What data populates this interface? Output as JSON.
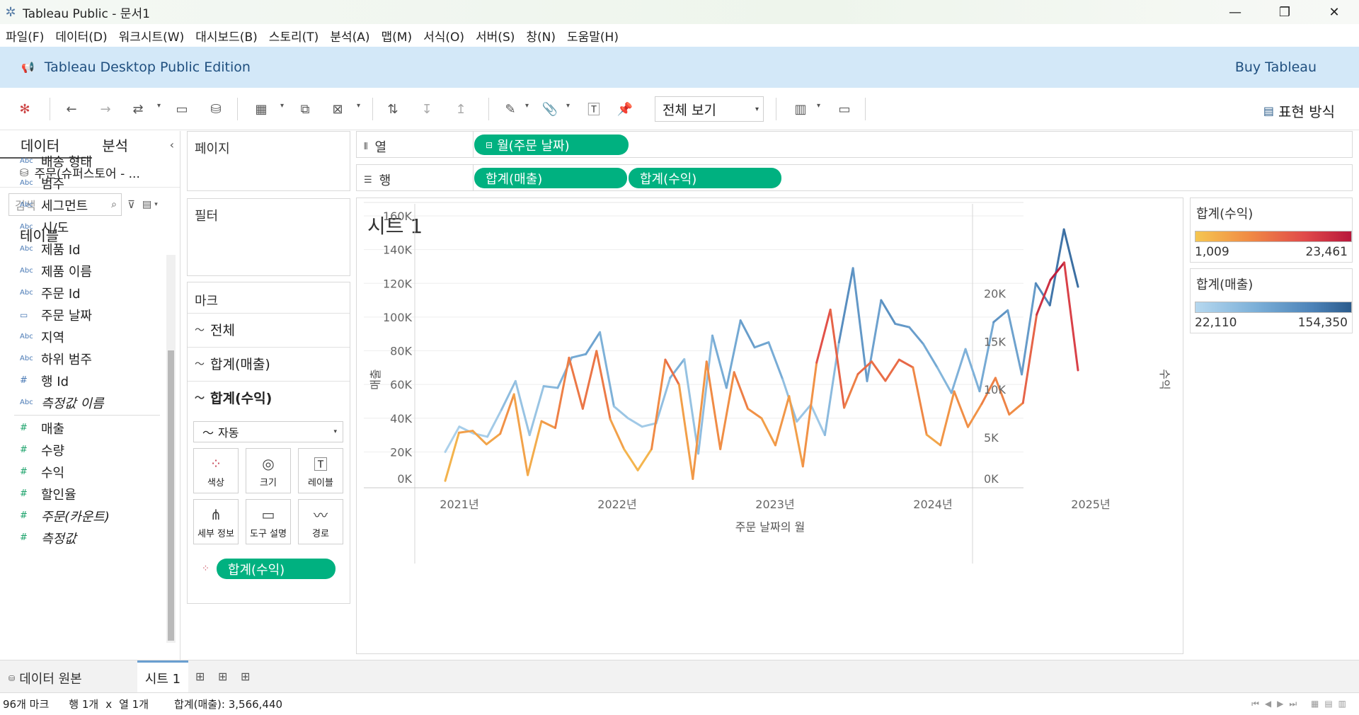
{
  "window": {
    "title": "Tableau Public - 문서1",
    "minimize_glyph": "—",
    "maximize_glyph": "❐",
    "close_glyph": "✕"
  },
  "menu": [
    "파일(F)",
    "데이터(D)",
    "워크시트(W)",
    "대시보드(B)",
    "스토리(T)",
    "분석(A)",
    "맵(M)",
    "서식(O)",
    "서버(S)",
    "창(N)",
    "도움말(H)"
  ],
  "banner": {
    "edition": "Tableau Desktop Public Edition",
    "buy": "Buy Tableau"
  },
  "toolbar": {
    "fit_value": "전체 보기",
    "show_me": "표현 방식",
    "icons": [
      "tableau-logo-icon",
      "undo-icon",
      "redo-icon",
      "replay-icon",
      "save-icon",
      "new-datasource-icon",
      "new-worksheet-icon",
      "duplicate-icon",
      "clear-icon",
      "swap-icon",
      "sort-asc-icon",
      "sort-desc-icon",
      "highlight-icon",
      "group-icon",
      "label-icon",
      "pin-icon",
      "chart-size-icon",
      "presentation-icon"
    ]
  },
  "data_pane": {
    "tab_data": "데이터",
    "tab_analysis": "분석",
    "datasource": "주문(슈퍼스토어 - ...",
    "search_placeholder": "검색",
    "tables_heading": "테이블",
    "dimensions": [
      {
        "type": "Abc",
        "name": "배송 형태"
      },
      {
        "type": "Abc",
        "name": "범주"
      },
      {
        "type": "Abc",
        "name": "세그먼트"
      },
      {
        "type": "Abc",
        "name": "시/도"
      },
      {
        "type": "Abc",
        "name": "제품 Id"
      },
      {
        "type": "Abc",
        "name": "제품 이름"
      },
      {
        "type": "Abc",
        "name": "주문 Id"
      },
      {
        "type": "date",
        "name": "주문 날짜"
      },
      {
        "type": "Abc",
        "name": "지역"
      },
      {
        "type": "Abc",
        "name": "하위 범주"
      },
      {
        "type": "#",
        "name": "행 Id"
      },
      {
        "type": "Abc",
        "name": "측정값 이름"
      }
    ],
    "measures": [
      {
        "type": "#",
        "name": "매출"
      },
      {
        "type": "#",
        "name": "수량"
      },
      {
        "type": "#",
        "name": "수익"
      },
      {
        "type": "#",
        "name": "할인율"
      },
      {
        "type": "#",
        "name": "주문(카운트)"
      },
      {
        "type": "#",
        "name": "측정값"
      }
    ]
  },
  "shelves": {
    "pages": "페이지",
    "filters": "필터",
    "marks": "마크",
    "columns_label": "열",
    "rows_label": "행",
    "column_pill": "월(주문 날짜)",
    "row_pills": [
      "합계(매출)",
      "합계(수익)"
    ]
  },
  "marks": {
    "all": "전체",
    "sales": "합계(매출)",
    "profit": "합계(수익)",
    "mark_type": "자동",
    "buttons": [
      {
        "label": "색상",
        "icon": "color-icon"
      },
      {
        "label": "크기",
        "icon": "size-icon"
      },
      {
        "label": "레이블",
        "icon": "label-icon"
      },
      {
        "label": "세부 정보",
        "icon": "detail-icon"
      },
      {
        "label": "도구 설명",
        "icon": "tooltip-icon"
      },
      {
        "label": "경로",
        "icon": "path-icon"
      }
    ],
    "color_pill": "합계(수익)"
  },
  "legends": {
    "profit": {
      "title": "합계(수익)",
      "min": "1,009",
      "max": "23,461"
    },
    "sales": {
      "title": "합계(매출)",
      "min": "22,110",
      "max": "154,350"
    }
  },
  "sheet": {
    "title": "시트 1"
  },
  "chart_data": {
    "type": "line",
    "xlabel": "주문 날짜의 월",
    "ylabel_left": "매출",
    "ylabel_right": "수익",
    "x_ticks": [
      "2021년",
      "2022년",
      "2023년",
      "2024년",
      "2025년"
    ],
    "x_start": "2021-01",
    "x_end": "2024-12",
    "y_left_ticks": [
      "0K",
      "20K",
      "40K",
      "60K",
      "80K",
      "100K",
      "120K",
      "140K",
      "160K"
    ],
    "y_left_range": [
      0,
      160000
    ],
    "y_right_ticks": [
      "0K",
      "5K",
      "10K",
      "15K",
      "20K"
    ],
    "y_right_range": [
      0,
      24000
    ],
    "grid": true,
    "series": [
      {
        "name": "합계(매출)",
        "axis": "left",
        "color_measure": "sales",
        "values": [
          20000,
          35000,
          31000,
          29000,
          45000,
          62000,
          30000,
          59000,
          58000,
          76000,
          78000,
          91000,
          47000,
          40000,
          35000,
          37000,
          64000,
          75000,
          19000,
          89000,
          58000,
          98000,
          82000,
          85000,
          63000,
          38000,
          48000,
          30000,
          85000,
          129000,
          62000,
          110000,
          96000,
          94000,
          84000,
          70000,
          55000,
          81000,
          56000,
          97000,
          104000,
          66000,
          120000,
          107000,
          152000,
          118000
        ]
      },
      {
        "name": "합계(수익)",
        "axis": "right",
        "color_measure": "profit",
        "values": [
          500,
          5500,
          5700,
          4300,
          5400,
          9500,
          1100,
          6700,
          6000,
          13300,
          8000,
          14000,
          6900,
          3800,
          1600,
          3800,
          13100,
          10500,
          700,
          12900,
          3800,
          11800,
          8000,
          7000,
          4200,
          9300,
          2000,
          12800,
          18300,
          8100,
          11600,
          12900,
          10900,
          13100,
          12300,
          5300,
          4200,
          9800,
          6100,
          8500,
          11200,
          7400,
          8600,
          17800,
          21400,
          23200,
          12000
        ]
      }
    ]
  },
  "bottom_tabs": {
    "datasource": "데이터 원본",
    "sheet": "시트 1"
  },
  "status": {
    "marks": "96개 마크",
    "rows": "행 1개",
    "x": "x",
    "cols": "열 1개",
    "sum": "합계(매출): 3,566,440"
  }
}
